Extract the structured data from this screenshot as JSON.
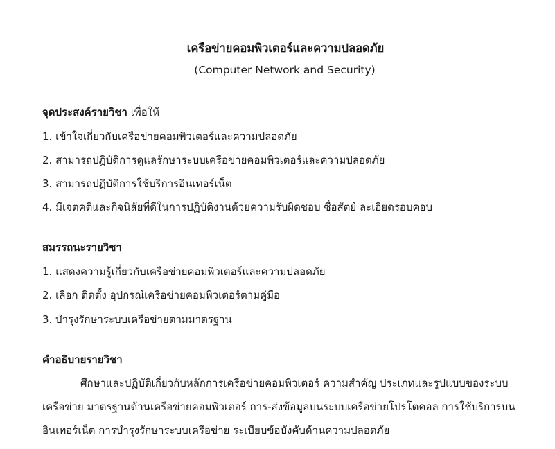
{
  "document": {
    "title": "เครือข่ายคอมพิวเตอร์และความปลอดภัย",
    "subtitle": "(Computer Network and Security)",
    "objectives": {
      "heading": "จุดประสงค์รายวิชา",
      "heading_suffix": " เพื่อให้",
      "items": [
        "1. เข้าใจเกี่ยวกับเครือข่ายคอมพิวเตอร์และความปลอดภัย",
        "2. สามารถปฏิบัติการดูแลรักษาระบบเครือข่ายคอมพิวเตอร์และความปลอดภัย",
        "3. สามารถปฏิบัติการใช้บริการอินเทอร์เน็ต",
        "4. มีเจตคติและกิจนิสัยที่ดีในการปฏิบัติงานด้วยความรับผิดชอบ ซื่อสัตย์ ละเอียดรอบคอบ"
      ]
    },
    "competencies": {
      "heading": "สมรรถนะรายวิชา",
      "items": [
        "1. แสดงความรู้เกี่ยวกับเครือข่ายคอมพิวเตอร์และความปลอดภัย",
        "2.  เลือก ติดตั้ง อุปกรณ์เครือข่ายคอมพิวเตอร์ตามคู่มือ",
        "3. บำรุงรักษาระบบเครือข่ายตามมาตรฐาน"
      ]
    },
    "description": {
      "heading": "คำอธิบายรายวิชา",
      "lines": [
        "ศึกษาและปฏิบัติเกี่ยวกับหลักการเครือข่ายคอมพิวเตอร์ ความสำคัญ ประเภทและรูปแบบของระบบ",
        "เครือข่าย มาตรฐานด้านเครือข่ายคอมพิวเตอร์ การ-ส่งข้อมูลบนระบบเครือข่ายโปรโตคอล การใช้บริการบน",
        "อินเทอร์เน็ต การบำรุงรักษาระบบเครือข่าย ระเบียบข้อบังคับด้านความปลอดภัย"
      ]
    }
  }
}
